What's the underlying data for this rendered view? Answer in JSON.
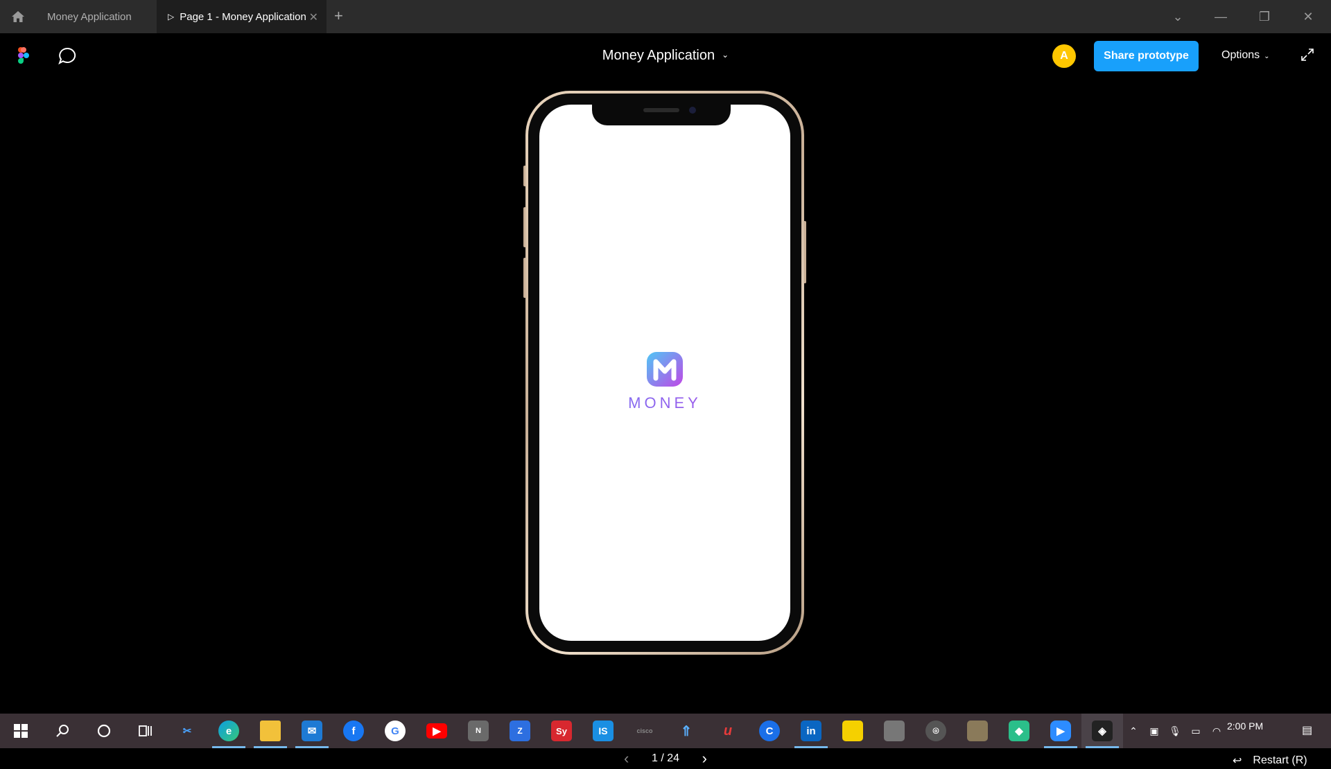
{
  "tabs": [
    {
      "label": "Money Application"
    },
    {
      "label": "Page 1 - Money Application"
    }
  ],
  "toolbar": {
    "title": "Money Application",
    "avatar_initial": "A",
    "share_label": "Share prototype",
    "options_label": "Options"
  },
  "prototype": {
    "logo_text": "MONEY"
  },
  "pager": {
    "label": "1 / 24"
  },
  "restart": {
    "label": "Restart (R)"
  },
  "taskbar": {
    "time": "2:00 PM"
  },
  "colors": {
    "share_button": "#18a0fb",
    "avatar": "#ffc700",
    "logo_gradient_start": "#4fc7f5",
    "logo_gradient_end": "#c047e6"
  }
}
